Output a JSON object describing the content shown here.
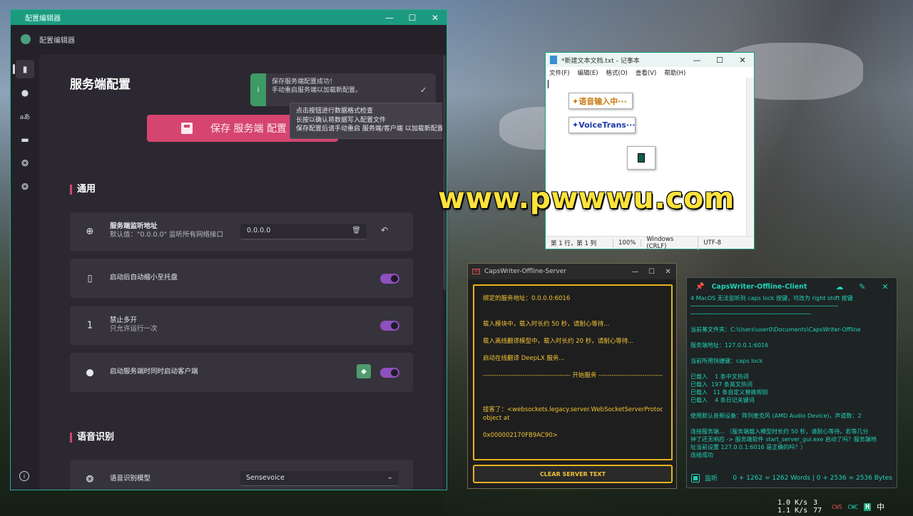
{
  "config_window": {
    "title": "配置编辑器",
    "app_name": "配置编辑器",
    "controls": {
      "min": "—",
      "max": "☐",
      "close": "✕"
    },
    "heading": "服务端配置",
    "toast": {
      "line1": "保存服务端配置成功！",
      "line2": "手动重启服务端以加载新配置。",
      "icon": "i",
      "check": "✓"
    },
    "save_button": "保存 服务端 配置",
    "tooltip": [
      "点击按钮进行数据格式检查",
      "长按以确认将数据写入配置文件",
      "保存配置后请手动重启 服务端/客户端 以加载新配置生效"
    ],
    "sections": {
      "general": "通用",
      "speech": "语音识别"
    },
    "settings": {
      "listen_address": {
        "label": "服务端监听地址",
        "desc": "默认值：\"0.0.0.0\" 监听所有网络接口",
        "value": "0.0.0.0"
      },
      "minimize_tray": {
        "label": "启动后自动缩小至托盘",
        "enabled": true
      },
      "single_instance": {
        "label": "禁止多开",
        "desc": "只允许运行一次",
        "enabled": true
      },
      "start_client": {
        "label": "启动服务端时同时启动客户端",
        "enabled": true
      },
      "speech_model": {
        "label": "语音识别模型",
        "value": "Sensevoice"
      }
    }
  },
  "notepad": {
    "title": "*新建文本文档.txt - 记事本",
    "menu": [
      "文件(F)",
      "编辑(E)",
      "格式(O)",
      "查看(V)",
      "帮助(H)"
    ],
    "floating_1": "✦语音输入中···",
    "floating_2": "✦VoiceTrans···",
    "status": {
      "pos": "第 1 行，第 1 列",
      "zoom": "100%",
      "eol": "Windows (CRLF)",
      "enc": "UTF-8"
    }
  },
  "watermark": "www.pwwwu.com",
  "server_window": {
    "title": "CapsWriter-Offline-Server",
    "icon": "CWS",
    "lines": [
      "绑定的服务地址：0.0.0.0:6016",
      "",
      "",
      "载入模块中，载入时长约 50 秒，请耐心等待...",
      "",
      "载入离线翻译模型中，载入时长约 20 秒，请耐心等待...",
      "",
      "启动在线翻译 DeepLX 服务...",
      "",
      "---------------------------------------- 开始服务 ----------------------------------------",
      "",
      "",
      "",
      "接客了：<websockets.legacy.server.WebSocketServerProtocol",
      "object at",
      "",
      "0x000002170FB9AC90>"
    ],
    "clear_button": "CLEAR SERVER TEXT"
  },
  "client_window": {
    "title": "CapsWriter-Offline-Client",
    "lines": [
      "4 MacOS 无法监听到 caps lock 按键，可改为 right shift 按键",
      "───────────────────────────────────────────",
      "───────────────────────────────────",
      "",
      "当前基文件夹：C:\\Users\\user0\\Documents\\CapsWriter-Offline",
      "",
      "服务端地址：127.0.0.1:6016",
      "",
      "当前所用快捷键：caps lock",
      "",
      "已载入    1 条中文热词",
      "已载入  197 条英文热词",
      "已载入   11 条自定义替换规则",
      "已载入    4 条日记关键词",
      "",
      "使用默认音频设备：阵列麦克风 (AMD Audio Device)，声道数：2",
      "",
      "连接服务端... （服务端载入模型时长约 50 秒，请耐心等待。若等几分",
      "钟了还无响应 -> 服务端软件 start_server_gui.exe 启动了吗？服务端地",
      "址当前设置 127.0.0.1:6016 是正确的吗？）",
      "连接成功"
    ],
    "monitor_label": "监听",
    "stats": "0 + 1262 = 1262 Words | 0 + 2536 = 2536 Bytes"
  },
  "tray": {
    "net_up": "1.0 K/s",
    "net_down": "1.1 K/s",
    "num1": "3",
    "num2": "77",
    "icons": [
      "CWS",
      "CWC",
      "H",
      "中"
    ]
  },
  "colors": {
    "accent_teal": "#1c9a80",
    "save_pink": "#d5456f",
    "toggle_purple": "#8e4fbf",
    "server_yellow": "#e6b31e",
    "client_cyan": "#1fd3b8"
  }
}
